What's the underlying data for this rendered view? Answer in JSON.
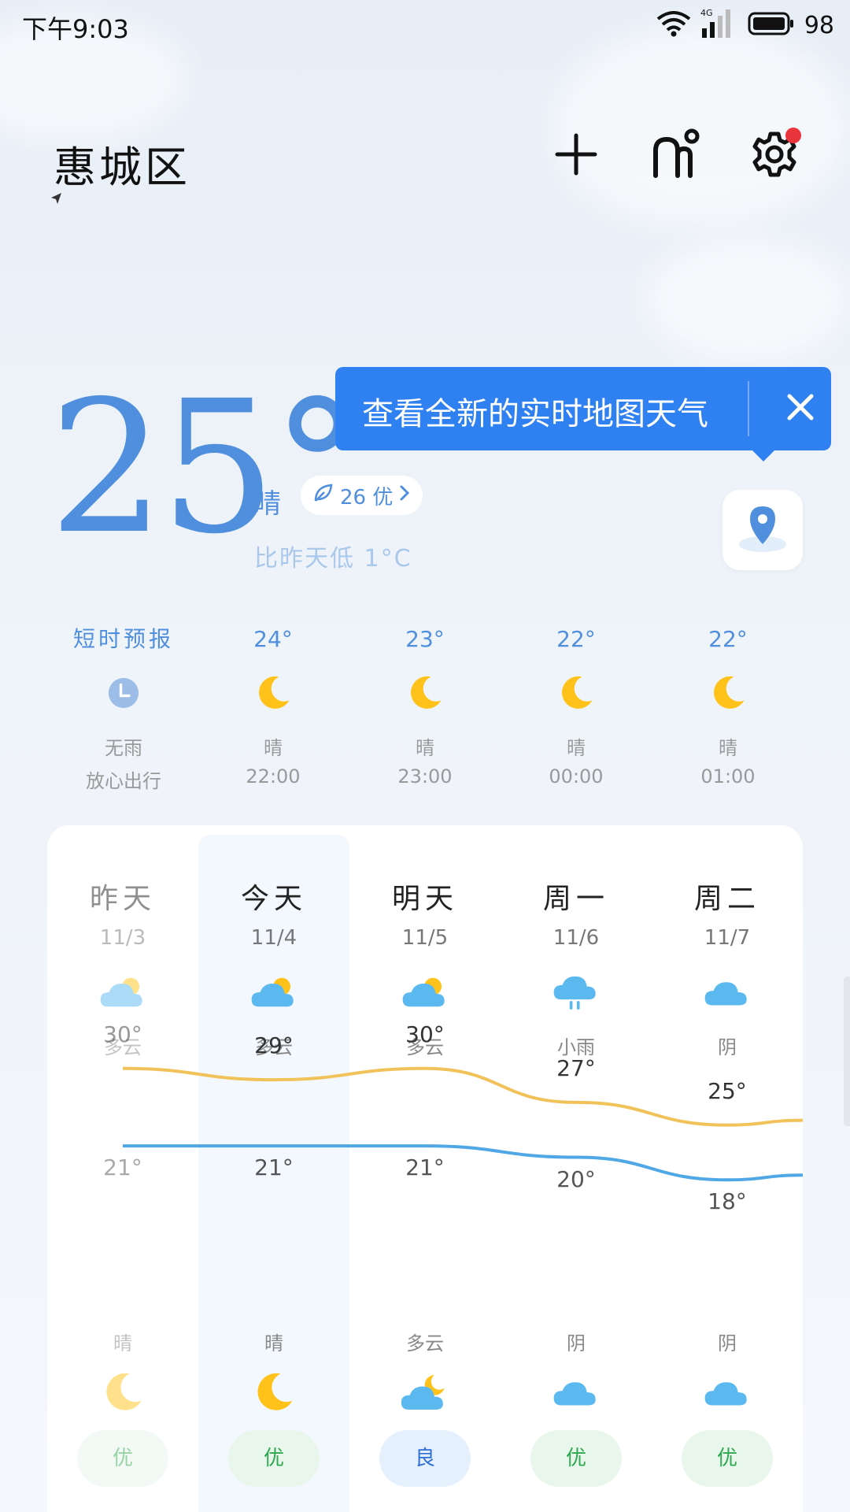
{
  "status_bar": {
    "time": "下午9:03",
    "network": "4G",
    "battery": "98"
  },
  "header": {
    "city": "惠城区",
    "icons": [
      "location-arrow-icon",
      "plus-icon",
      "profile-icon",
      "gear-icon"
    ]
  },
  "current": {
    "temp": "25°",
    "condition": "晴",
    "aqi_label": "26 优",
    "compare": "比昨天低 1°C"
  },
  "tooltip": {
    "text": "查看全新的实时地图天气"
  },
  "hourly": [
    {
      "top": "短时预报",
      "icon": "clock-icon",
      "cond": "无雨",
      "time": "放心出行"
    },
    {
      "top": "24°",
      "icon": "moon-icon",
      "cond": "晴",
      "time": "22:00"
    },
    {
      "top": "23°",
      "icon": "moon-icon",
      "cond": "晴",
      "time": "23:00"
    },
    {
      "top": "22°",
      "icon": "moon-icon",
      "cond": "晴",
      "time": "00:00"
    },
    {
      "top": "22°",
      "icon": "moon-icon",
      "cond": "晴",
      "time": "01:00"
    }
  ],
  "daily": [
    {
      "name": "昨天",
      "date": "11/3",
      "day_cond": "多云",
      "day_icon": "partly-cloudy-icon",
      "high": 30,
      "high_label": "30°",
      "low": 21,
      "low_label": "21°",
      "night_cond": "晴",
      "night_icon": "moon-icon",
      "aqi": "优"
    },
    {
      "name": "今天",
      "date": "11/4",
      "day_cond": "多云",
      "day_icon": "partly-cloudy-icon",
      "high": 29,
      "high_label": "29°",
      "low": 21,
      "low_label": "21°",
      "night_cond": "晴",
      "night_icon": "moon-icon",
      "aqi": "优"
    },
    {
      "name": "明天",
      "date": "11/5",
      "day_cond": "多云",
      "day_icon": "partly-cloudy-icon",
      "high": 30,
      "high_label": "30°",
      "low": 21,
      "low_label": "21°",
      "night_cond": "多云",
      "night_icon": "cloudy-night-icon",
      "aqi": "良"
    },
    {
      "name": "周一",
      "date": "11/6",
      "day_cond": "小雨",
      "day_icon": "light-rain-icon",
      "high": 27,
      "high_label": "27°",
      "low": 20,
      "low_label": "20°",
      "night_cond": "阴",
      "night_icon": "overcast-icon",
      "aqi": "优"
    },
    {
      "name": "周二",
      "date": "11/7",
      "day_cond": "阴",
      "day_icon": "overcast-icon",
      "high": 25,
      "high_label": "25°",
      "low": 18,
      "low_label": "18°",
      "night_cond": "阴",
      "night_icon": "overcast-icon",
      "aqi": "优"
    }
  ],
  "colors": {
    "accent": "#4f8fdd",
    "tooltip_bg": "#2f80f0",
    "high_line": "#f2c25a",
    "low_line": "#4fa7e6",
    "aqi_good_bg": "#e8f6ec",
    "aqi_good_text": "#2fa84f",
    "aqi_fair_bg": "#e4f0fc",
    "aqi_fair_text": "#2f6fd8",
    "sun": "#ffc21a",
    "cloud": "#5bb9f0"
  }
}
